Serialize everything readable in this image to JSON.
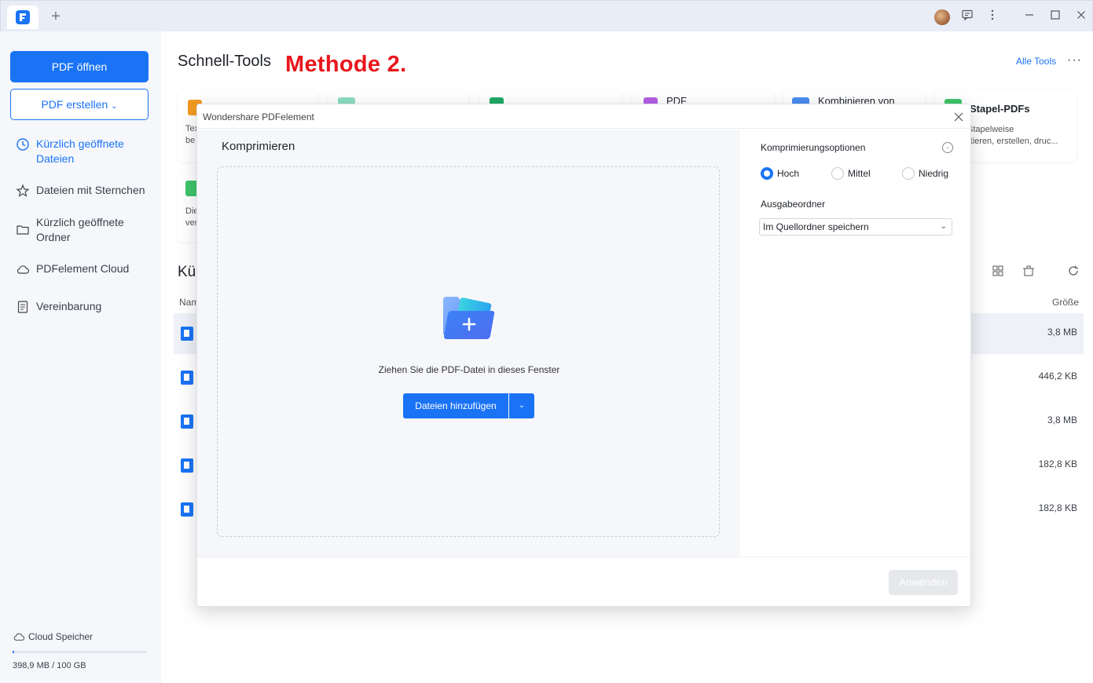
{
  "titlebar": {
    "new_tab": "+",
    "icons": [
      "avatar",
      "feedback-icon",
      "more-vertical-icon",
      "minimize-icon",
      "maximize-icon",
      "close-icon"
    ]
  },
  "sidebar": {
    "open_button": "PDF öffnen",
    "create_button": "PDF erstellen",
    "items": [
      {
        "label": "Kürzlich geöffnete Dateien",
        "icon": "clock-icon",
        "active": true
      },
      {
        "label": "Dateien mit Sternchen",
        "icon": "star-icon",
        "active": false
      },
      {
        "label": "Kürzlich geöffnete Ordner",
        "icon": "folder-icon",
        "active": false
      },
      {
        "label": "PDFelement Cloud",
        "icon": "cloud-icon",
        "active": false
      },
      {
        "label": "Vereinbarung",
        "icon": "document-icon",
        "active": false
      }
    ],
    "cloud_label": "Cloud Speicher",
    "storage_text": "398,9 MB / 100 GB",
    "storage_fraction": 0.004
  },
  "main": {
    "title": "Schnell-Tools",
    "annotation": "Methode 2.",
    "all_tools": "Alle Tools",
    "more": "···",
    "cards": [
      {
        "title": "",
        "desc": "Tex\nbe"
      },
      {
        "title": "PDF",
        "desc": ""
      },
      {
        "title": "Kombinieren von",
        "desc": ""
      },
      {
        "title": "Stapel-PDFs",
        "desc": "Stapelweise\nrtieren, erstellen, druc..."
      },
      {
        "title": "",
        "desc": "Die\nver"
      }
    ],
    "recent_heading": "Kü",
    "col_name": "Nam",
    "col_size": "Größe",
    "files": [
      {
        "size": "3,8 MB",
        "type": "pdf"
      },
      {
        "size": "446,2 KB",
        "type": "pdf"
      },
      {
        "size": "3,8 MB",
        "type": "pdf"
      },
      {
        "size": "182,8 KB",
        "type": "cloud"
      },
      {
        "size": "182,8 KB",
        "type": "cloud"
      }
    ]
  },
  "dialog": {
    "app_title": "Wondershare PDFelement",
    "heading": "Komprimieren",
    "drop_text": "Ziehen Sie die PDF-Datei in dieses Fenster",
    "add_button": "Dateien hinzufügen",
    "options_heading": "Komprimierungsoptionen",
    "radios": [
      {
        "label": "Hoch",
        "checked": true
      },
      {
        "label": "Mittel",
        "checked": false
      },
      {
        "label": "Niedrig",
        "checked": false
      }
    ],
    "output_heading": "Ausgabeordner",
    "output_value": "Im Quellordner speichern",
    "apply_button": "Anwenden"
  }
}
